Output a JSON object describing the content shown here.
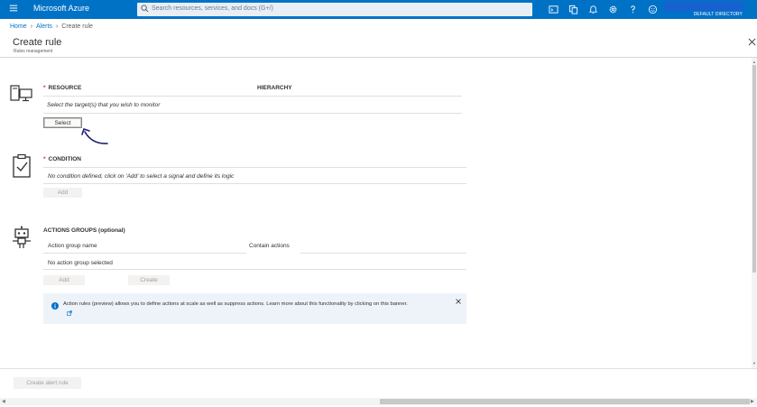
{
  "topbar": {
    "brand": "Microsoft Azure",
    "search_placeholder": "Search resources, services, and docs (G+/)",
    "icons": [
      "cloud-shell-icon",
      "directory-filter-icon",
      "notifications-icon",
      "settings-icon",
      "help-icon",
      "feedback-icon"
    ],
    "directory": "DEFAULT DIRECTORY",
    "bg_color": "#0072c6"
  },
  "breadcrumb": {
    "items": [
      "Home",
      "Alerts",
      "Create rule"
    ]
  },
  "blade": {
    "title": "Create rule",
    "subtitle": "Rules management"
  },
  "resource": {
    "label": "RESOURCE",
    "hierarchy_label": "HIERARCHY",
    "placeholder": "Select the target(s) that you wish to monitor",
    "select_button": "Select"
  },
  "condition": {
    "label": "CONDITION",
    "placeholder": "No condition defined, click on 'Add' to select a signal and define its logic",
    "add_button": "Add"
  },
  "actions": {
    "label": "ACTIONS GROUPS (optional)",
    "col_name": "Action group name",
    "col_contains": "Contain actions",
    "empty_text": "No action group selected",
    "add_button": "Add",
    "create_button": "Create",
    "info_text": "Action rules (preview) allows you to define actions at scale as well as suppress actions. Learn more about this functionality by clicking on this banner."
  },
  "footer": {
    "create_alert_button": "Create alert rule"
  },
  "required_marker": "*"
}
